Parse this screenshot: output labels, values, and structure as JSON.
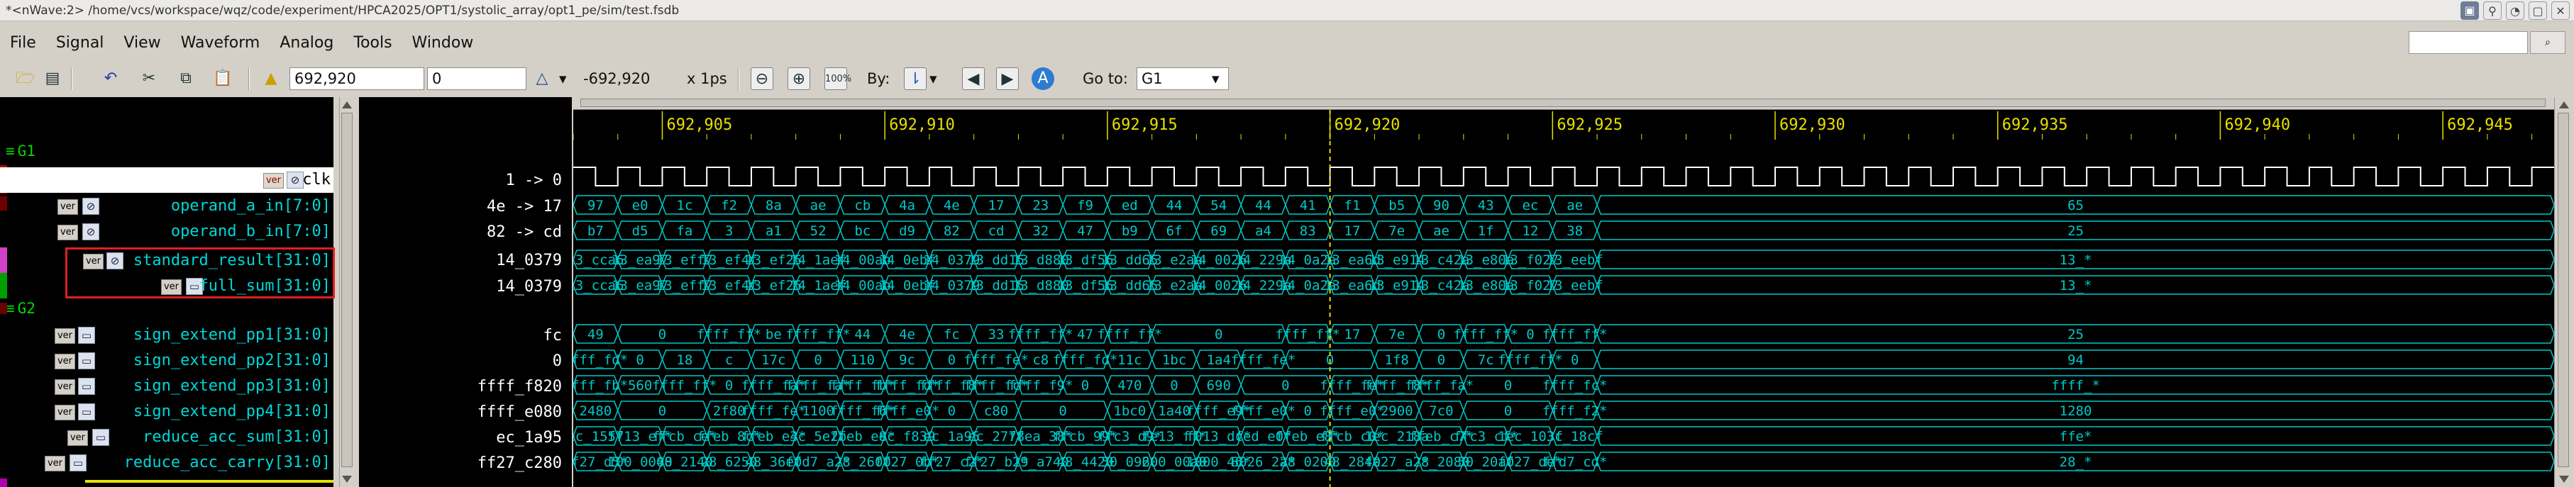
{
  "window": {
    "title": "*<nWave:2> /home/vcs/workspace/wqz/code/experiment/HPCA2025/OPT1/systolic_array/opt1_pe/sim/test.fsdb"
  },
  "menu": [
    "File",
    "Signal",
    "View",
    "Waveform",
    "Analog",
    "Tools",
    "Window"
  ],
  "toolbar": {
    "cursor_time": "692,920",
    "marker_time": "0",
    "delta": "-692,920",
    "timescale": "x 1ps",
    "by_label": "By:",
    "goto_label": "Go to:",
    "goto_value": "G1"
  },
  "icons": {
    "open": "folder-open-icon",
    "save": "save-icon",
    "undo": "undo-icon",
    "cut": "cut-icon",
    "copy": "copy-icon",
    "paste": "paste-icon",
    "cursor": "cursor-icon",
    "delta": "delta-icon",
    "zoom_out": "zoom-out-icon",
    "zoom_in": "zoom-in-icon",
    "zoom_100": "zoom-fit-icon",
    "search_by": "search-by-icon",
    "prev": "previous-icon",
    "next": "next-icon",
    "analog": "analog-icon"
  },
  "signal_panel": {
    "groups": [
      {
        "name": "G1"
      },
      {
        "name": "G2"
      }
    ],
    "signals": [
      {
        "name": "clk",
        "badge": "ver",
        "selected": true
      },
      {
        "name": "operand_a_in[7:0]",
        "badge": "ver"
      },
      {
        "name": "operand_b_in[7:0]",
        "badge": "ver"
      },
      {
        "name": "standard_result[31:0]",
        "badge": "ver"
      },
      {
        "name": "full_sum[31:0]",
        "badge": "ver"
      },
      {
        "name": "sign_extend_pp1[31:0]",
        "badge": "ver"
      },
      {
        "name": "sign_extend_pp2[31:0]",
        "badge": "ver"
      },
      {
        "name": "sign_extend_pp3[31:0]",
        "badge": "ver"
      },
      {
        "name": "sign_extend_pp4[31:0]",
        "badge": "ver"
      },
      {
        "name": "reduce_acc_sum[31:0]",
        "badge": "ver"
      },
      {
        "name": "reduce_acc_carry[31:0]",
        "badge": "ver"
      }
    ]
  },
  "value_panel": {
    "values": [
      "1 -> 0",
      "4e -> 17",
      "82 -> cd",
      "14_0379",
      "14_0379",
      "fc",
      "0",
      "ffff_f820",
      "ffff_e080",
      "ec_1a95",
      "ff27_c280"
    ]
  },
  "ruler": {
    "labels": [
      "692,905",
      "692,910",
      "692,915",
      "692,920",
      "692,925",
      "692,930",
      "692,935",
      "692,940",
      "692,945"
    ]
  },
  "colors": {
    "wave_bg": "#000000",
    "wave_fg": "#00c8c8",
    "clk": "#ffffff",
    "ruler_text": "#e7e000",
    "cursor": "#e7e000",
    "group_text": "#00d900",
    "highlight_box": "#e02020"
  },
  "waveform": {
    "cursor_time": 692920,
    "t_start": 692903,
    "t_end": 692947.5,
    "clk_period": 1,
    "buses": [
      {
        "signal": "operand_a_in[7:0]",
        "segments": [
          [
            "97",
            692903
          ],
          [
            "e0",
            692904
          ],
          [
            "1c",
            692905
          ],
          [
            "f2",
            692906
          ],
          [
            "8a",
            692907
          ],
          [
            "ae",
            692908
          ],
          [
            "cb",
            692909
          ],
          [
            "4a",
            692910
          ],
          [
            "4e",
            692911
          ],
          [
            "17",
            692912
          ],
          [
            "23",
            692913
          ],
          [
            "f9",
            692914
          ],
          [
            "ed",
            692915
          ],
          [
            "44",
            692916
          ],
          [
            "54",
            692917
          ],
          [
            "44",
            692918
          ],
          [
            "41",
            692919
          ],
          [
            "f1",
            692920
          ],
          [
            "b5",
            692921
          ],
          [
            "90",
            692922
          ],
          [
            "43",
            692923
          ],
          [
            "ec",
            692924
          ],
          [
            "ae",
            692925
          ],
          [
            "65",
            692926
          ]
        ]
      },
      {
        "signal": "operand_b_in[7:0]",
        "segments": [
          [
            "b7",
            692903
          ],
          [
            "d5",
            692904
          ],
          [
            "fa",
            692905
          ],
          [
            "3",
            692906
          ],
          [
            "a1",
            692907
          ],
          [
            "52",
            692908
          ],
          [
            "bc",
            692909
          ],
          [
            "d9",
            692910
          ],
          [
            "82",
            692911
          ],
          [
            "cd",
            692912
          ],
          [
            "32",
            692913
          ],
          [
            "47",
            692914
          ],
          [
            "b9",
            692915
          ],
          [
            "6f",
            692916
          ],
          [
            "69",
            692917
          ],
          [
            "a4",
            692918
          ],
          [
            "83",
            692919
          ],
          [
            "17",
            692920
          ],
          [
            "7e",
            692921
          ],
          [
            "ae",
            692922
          ],
          [
            "1f",
            692923
          ],
          [
            "12",
            692924
          ],
          [
            "38",
            692925
          ],
          [
            "25",
            692926
          ]
        ]
      },
      {
        "signal": "standard_result[31:0]",
        "segments": [
          [
            "13_cca6",
            692903
          ],
          [
            "13_ea97",
            692904
          ],
          [
            "13_eff7",
            692905
          ],
          [
            "13_ef4f",
            692906
          ],
          [
            "13_ef25",
            692907
          ],
          [
            "14_1aef",
            692908
          ],
          [
            "14_00ab",
            692909
          ],
          [
            "14_0ebf",
            692910
          ],
          [
            "14_0379",
            692911
          ],
          [
            "13_dd15",
            692912
          ],
          [
            "13_d880",
            692913
          ],
          [
            "13_df56",
            692914
          ],
          [
            "13_dd65",
            692915
          ],
          [
            "13_e2aa",
            692916
          ],
          [
            "14_0026",
            692917
          ],
          [
            "14_229a",
            692918
          ],
          [
            "14_0a2a",
            692919
          ],
          [
            "13_ea6d",
            692920
          ],
          [
            "13_e914",
            692921
          ],
          [
            "13_c42a",
            692922
          ],
          [
            "13_e80a",
            692923
          ],
          [
            "13_f027",
            692924
          ],
          [
            "13_eebf",
            692925
          ],
          [
            "13_*",
            692926
          ]
        ]
      },
      {
        "signal": "full_sum[31:0]",
        "segments": [
          [
            "13_cca6",
            692903
          ],
          [
            "13_ea97",
            692904
          ],
          [
            "13_eff7",
            692905
          ],
          [
            "13_ef4f",
            692906
          ],
          [
            "13_ef25",
            692907
          ],
          [
            "14_1aef",
            692908
          ],
          [
            "14_00ab",
            692909
          ],
          [
            "14_0ebf",
            692910
          ],
          [
            "14_0379",
            692911
          ],
          [
            "13_dd15",
            692912
          ],
          [
            "13_d880",
            692913
          ],
          [
            "13_df56",
            692914
          ],
          [
            "13_dd65",
            692915
          ],
          [
            "13_e2aa",
            692916
          ],
          [
            "14_0026",
            692917
          ],
          [
            "14_229a",
            692918
          ],
          [
            "14_0a2a",
            692919
          ],
          [
            "13_ea6d",
            692920
          ],
          [
            "13_e914",
            692921
          ],
          [
            "13_c42a",
            692922
          ],
          [
            "13_e80a",
            692923
          ],
          [
            "13_f027",
            692924
          ],
          [
            "13_eebf",
            692925
          ],
          [
            "13_*",
            692926
          ]
        ]
      },
      {
        "signal": "sign_extend_pp1[31:0]",
        "segments": [
          [
            "49",
            692903
          ],
          [
            "0",
            692904
          ],
          [
            "ffff_ff*",
            692906
          ],
          [
            "be",
            692907
          ],
          [
            "ffff_ff*",
            692908
          ],
          [
            "44",
            692909
          ],
          [
            "4e",
            692910
          ],
          [
            "fc",
            692911
          ],
          [
            "33",
            692912
          ],
          [
            "ffff_ff*",
            692913
          ],
          [
            "47",
            692914
          ],
          [
            "ffff_ff*",
            692915
          ],
          [
            "0",
            692916
          ],
          [
            "ffff_ff*",
            692919
          ],
          [
            "17",
            692920
          ],
          [
            "7e",
            692921
          ],
          [
            "0",
            692922
          ],
          [
            "ffff_ff*",
            692923
          ],
          [
            "0",
            692924
          ],
          [
            "ffff_ff*",
            692925
          ],
          [
            "25",
            692926
          ]
        ]
      },
      {
        "signal": "sign_extend_pp2[31:0]",
        "segments": [
          [
            "ffff_fd*",
            692903
          ],
          [
            "0",
            692904
          ],
          [
            "18",
            692905
          ],
          [
            "c",
            692906
          ],
          [
            "17c",
            692907
          ],
          [
            "0",
            692908
          ],
          [
            "110",
            692909
          ],
          [
            "9c",
            692910
          ],
          [
            "0",
            692911
          ],
          [
            "ffff_fe*",
            692912
          ],
          [
            "c8",
            692913
          ],
          [
            "ffff_fd*",
            692914
          ],
          [
            "11c",
            692915
          ],
          [
            "1bc",
            692916
          ],
          [
            "1a4",
            692917
          ],
          [
            "ffff_fe*",
            692918
          ],
          [
            "0",
            692919
          ],
          [
            "1f8",
            692921
          ],
          [
            "0",
            692922
          ],
          [
            "7c",
            692923
          ],
          [
            "ffff_ff*",
            692924
          ],
          [
            "0",
            692925
          ],
          [
            "94",
            692926
          ]
        ]
      },
      {
        "signal": "sign_extend_pp3[31:0]",
        "segments": [
          [
            "ffff_fb*",
            692903
          ],
          [
            "560",
            692904
          ],
          [
            "ffff_ff*",
            692905
          ],
          [
            "0",
            692906
          ],
          [
            "ffff_fa*",
            692907
          ],
          [
            "ffff_fa*",
            692908
          ],
          [
            "ffff_fb*",
            692909
          ],
          [
            "ffff_fd*",
            692910
          ],
          [
            "ffff_f8*",
            692911
          ],
          [
            "ffff_fc*",
            692912
          ],
          [
            "ffff_f9*",
            692913
          ],
          [
            "0",
            692914
          ],
          [
            "470",
            692915
          ],
          [
            "0",
            692916
          ],
          [
            "690",
            692917
          ],
          [
            "0",
            692918
          ],
          [
            "ffff_fe*",
            692920
          ],
          [
            "ffff_f8*",
            692921
          ],
          [
            "ffff_fa*",
            692922
          ],
          [
            "0",
            692923
          ],
          [
            "ffff_fc*",
            692925
          ],
          [
            "ffff_*",
            692926
          ]
        ]
      },
      {
        "signal": "sign_extend_pp4[31:0]",
        "segments": [
          [
            "2480",
            692903
          ],
          [
            "0",
            692904
          ],
          [
            "2f80",
            692906
          ],
          [
            "ffff_fe*",
            692907
          ],
          [
            "1100",
            692908
          ],
          [
            "ffff_f6*",
            692909
          ],
          [
            "ffff_e0*",
            692910
          ],
          [
            "0",
            692911
          ],
          [
            "c80",
            692912
          ],
          [
            "0",
            692913
          ],
          [
            "1bc0",
            692915
          ],
          [
            "1a40",
            692916
          ],
          [
            "ffff_e9*",
            692917
          ],
          [
            "ffff_e0*",
            692918
          ],
          [
            "0",
            692919
          ],
          [
            "ffff_e0*",
            692920
          ],
          [
            "2900",
            692921
          ],
          [
            "7c0",
            692922
          ],
          [
            "0",
            692923
          ],
          [
            "ffff_f2*",
            692925
          ],
          [
            "1280",
            692926
          ]
        ]
      },
      {
        "signal": "reduce_acc_sum[31:0]",
        "segments": [
          [
            "ec_1557",
            692903
          ],
          [
            "ff13_ef*",
            692904
          ],
          [
            "ffcb_ce*",
            692905
          ],
          [
            "ffeb_8c*",
            692906
          ],
          [
            "ffeb_e4*",
            692907
          ],
          [
            "3c_5e2b",
            692908
          ],
          [
            "ffeb_e8*",
            692909
          ],
          [
            "ec_f839",
            692910
          ],
          [
            "ec_1a95",
            692911
          ],
          [
            "ec_2778",
            692912
          ],
          [
            "ffea_38*",
            692913
          ],
          [
            "ffcb_99*",
            692914
          ],
          [
            "ffc3_d9*",
            692915
          ],
          [
            "fe13_ff*",
            692916
          ],
          [
            "f013_dc*",
            692917
          ],
          [
            "fed_e0*",
            692918
          ],
          [
            "ffeb_e8*",
            692919
          ],
          [
            "ffcb_c0*",
            692920
          ],
          [
            "1ec_218a",
            692921
          ],
          [
            "ffeb_c7*",
            692922
          ],
          [
            "ffc3_cf*",
            692923
          ],
          [
            "1ec_103f",
            692924
          ],
          [
            "3c_18cf",
            692925
          ],
          [
            "ffe*",
            692926
          ]
        ]
      },
      {
        "signal": "reduce_acc_carry[31:0]",
        "segments": [
          [
            "ff27_d5*",
            692903
          ],
          [
            "100_0000",
            692904
          ],
          [
            "48_2140",
            692905
          ],
          [
            "28_6250",
            692906
          ],
          [
            "48_36e0",
            692907
          ],
          [
            "ffd7_a2*",
            692908
          ],
          [
            "28_2600",
            692909
          ],
          [
            "ff27_0b*",
            692910
          ],
          [
            "ff27_c2*",
            692911
          ],
          [
            "ff27_b1*",
            692912
          ],
          [
            "29_a740",
            692913
          ],
          [
            "48_4420",
            692914
          ],
          [
            "50_0960",
            692915
          ],
          [
            "200_00a0",
            692916
          ],
          [
            "1000_46*",
            692917
          ],
          [
            "8026_2a*",
            692918
          ],
          [
            "28_0200",
            692919
          ],
          [
            "48_2840",
            692920
          ],
          [
            "fe27_a2*",
            692921
          ],
          [
            "28_2080",
            692922
          ],
          [
            "50_20a0",
            692923
          ],
          [
            "ff27_de*",
            692924
          ],
          [
            "ffd7_cd*",
            692925
          ],
          [
            "28_*",
            692926
          ]
        ]
      }
    ]
  }
}
